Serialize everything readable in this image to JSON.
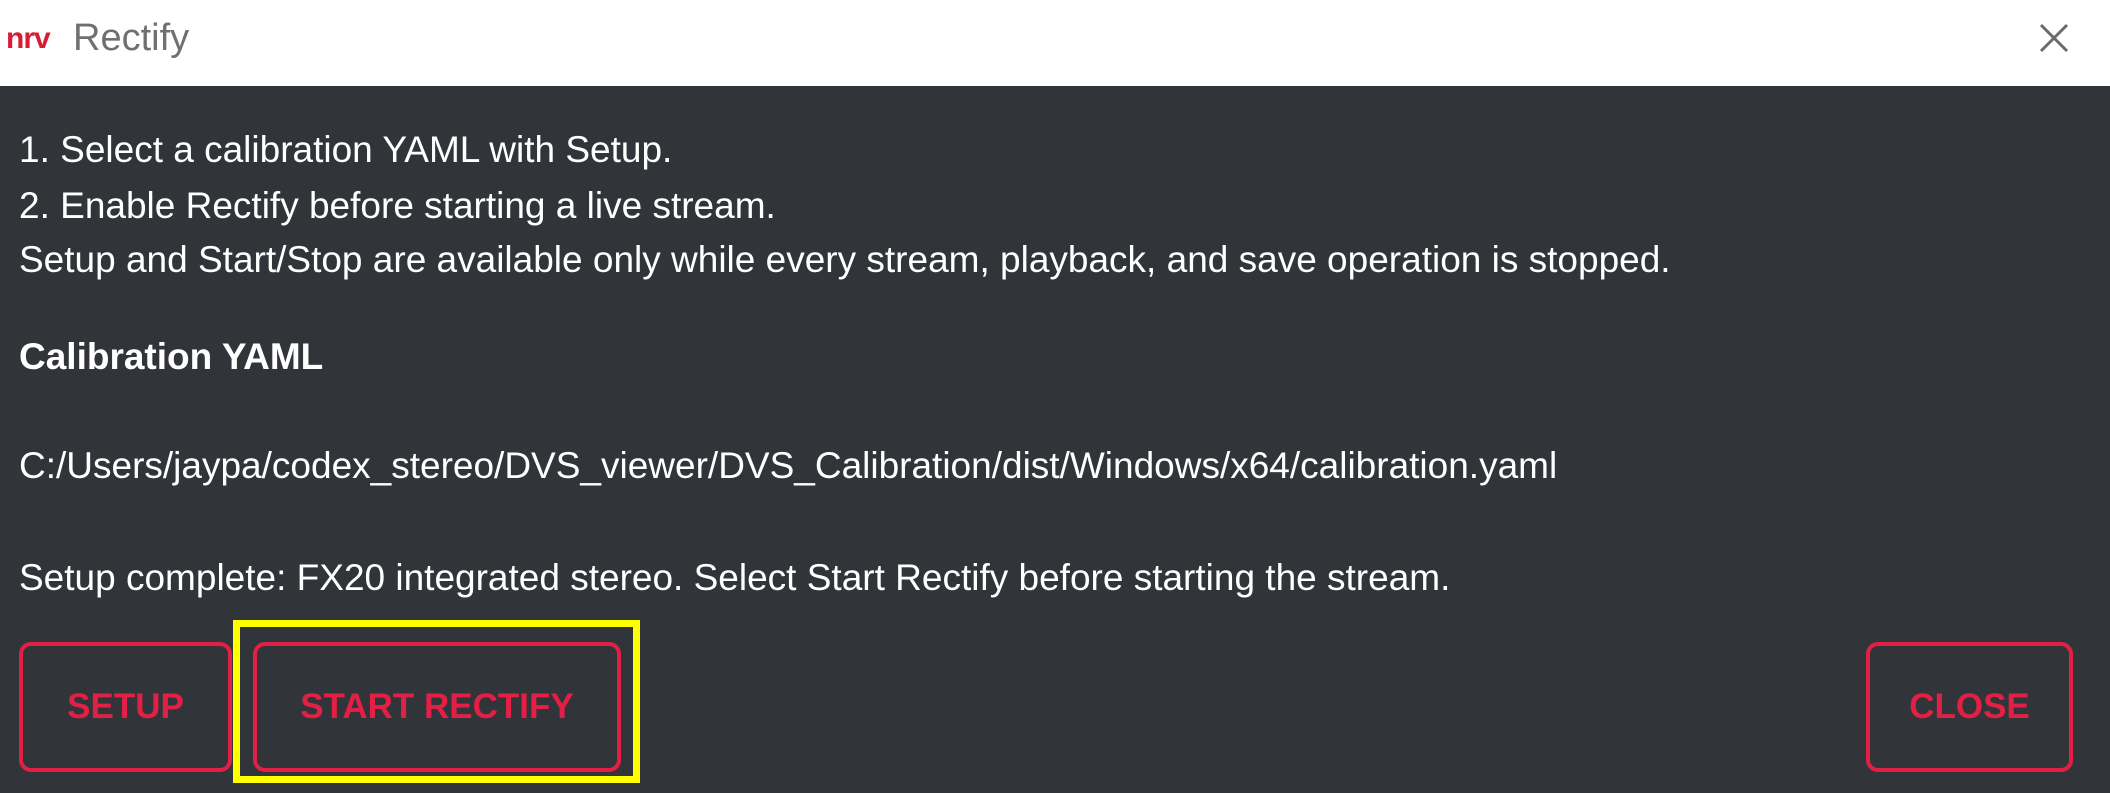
{
  "window": {
    "logo_text": "nrv",
    "title": "Rectify",
    "close_icon": "close-icon"
  },
  "instructions": [
    "1. Select a calibration YAML with Setup.",
    "2. Enable Rectify before starting a live stream.",
    "Setup and Start/Stop are available only while every stream, playback, and save operation is stopped."
  ],
  "calibration": {
    "heading": "Calibration YAML",
    "path": "C:/Users/jaypa/codex_stereo/DVS_viewer/DVS_Calibration/dist/Windows/x64/calibration.yaml",
    "status": "Setup complete: FX20 integrated stereo. Select Start Rectify before starting the stream."
  },
  "buttons": {
    "setup": "SETUP",
    "start_rectify": "START RECTIFY",
    "close": "CLOSE"
  },
  "colors": {
    "background": "#313539",
    "accent": "#e21f45",
    "highlight": "#ffff00",
    "logo": "#d91c33"
  }
}
